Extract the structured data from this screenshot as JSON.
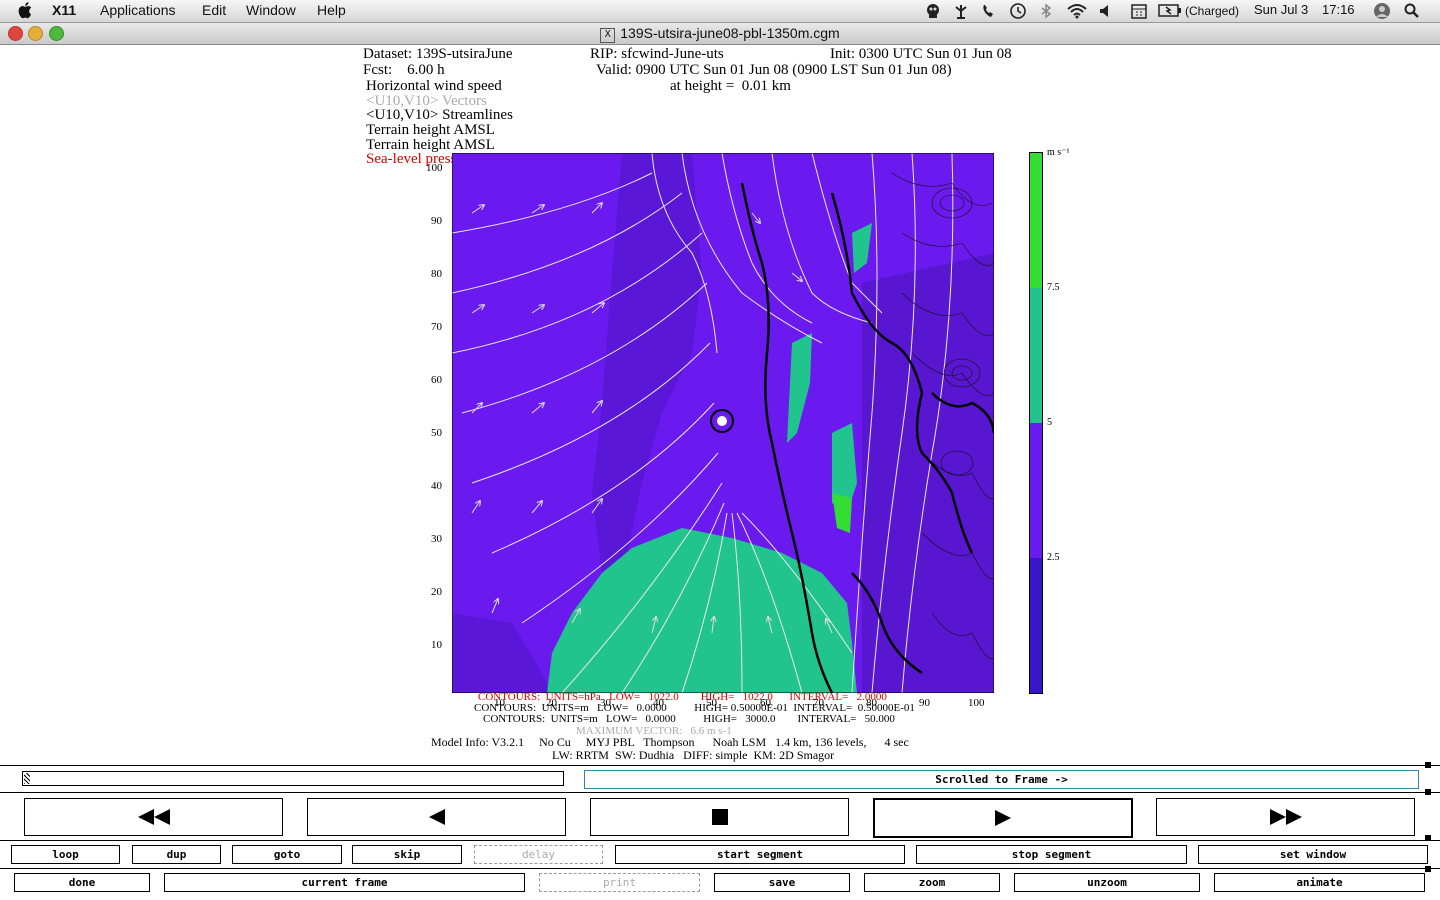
{
  "menubar": {
    "app": "X11",
    "items": [
      "Applications",
      "Edit",
      "Window",
      "Help"
    ],
    "battery": "(Charged)",
    "date": "Sun Jul 3",
    "time": "17:16"
  },
  "window": {
    "title": "139S-utsira-june08-pbl-1350m.cgm"
  },
  "plot": {
    "header": {
      "dataset": "Dataset: 139S-utsiraJune",
      "rip": "RIP: sfcwind-June-uts",
      "init": "Init: 0300 UTC Sun 01 Jun 08",
      "fcst": "Fcst:    6.00 h",
      "valid": "Valid: 0900 UTC Sun 01 Jun 08 (0900 LST Sun 01 Jun 08)",
      "field1": "Horizontal wind speed",
      "height": "at height =  0.01 km",
      "field2": "<U10,V10> Vectors",
      "field3": "<U10,V10> Streamlines",
      "field4": "Terrain height AMSL",
      "field5": "Terrain height AMSL",
      "field6": "Sea-level pressure"
    },
    "y_ticks": [
      "100",
      "90",
      "80",
      "70",
      "60",
      "50",
      "40",
      "30",
      "20",
      "10"
    ],
    "x_ticks": [
      "10",
      "20",
      "30",
      "40",
      "50",
      "60",
      "70",
      "80",
      "90",
      "100"
    ],
    "colorbar": {
      "units": "m s⁻¹",
      "labels": [
        "7.5",
        "5",
        "2.5"
      ],
      "colors": [
        "#33dd33",
        "#22c48e",
        "#6a1aee",
        "#3a14c8"
      ]
    },
    "footer": {
      "line1": "CONTOURS:  UNITS=hPa   LOW=   1022.0        HIGH=   1022.0      INTERVAL=   2.0000",
      "line2": "CONTOURS:  UNITS=m   LOW=   0.0000          HIGH= 0.50000E-01  INTERVAL=  0.50000E-01",
      "line3": "CONTOURS:  UNITS=m   LOW=   0.0000          HIGH=   3000.0        INTERVAL=   50.000",
      "line4": "MAXIMUM VECTOR:   6.6 m s-1",
      "model1": "Model Info: V3.2.1     No Cu     MYJ PBL   Thompson      Noah LSM   1.4 km, 136 levels,      4 sec",
      "model2": "LW: RRTM  SW: Dudhia   DIFF: simple  KM: 2D Smagor"
    }
  },
  "controls": {
    "frame_status": "Scrolled to Frame ->",
    "row1": [
      "loop",
      "dup",
      "goto",
      "skip",
      "delay",
      "start segment",
      "stop segment",
      "set window"
    ],
    "row2": [
      "done",
      "current frame",
      "print",
      "save",
      "zoom",
      "unzoom",
      "animate"
    ]
  }
}
